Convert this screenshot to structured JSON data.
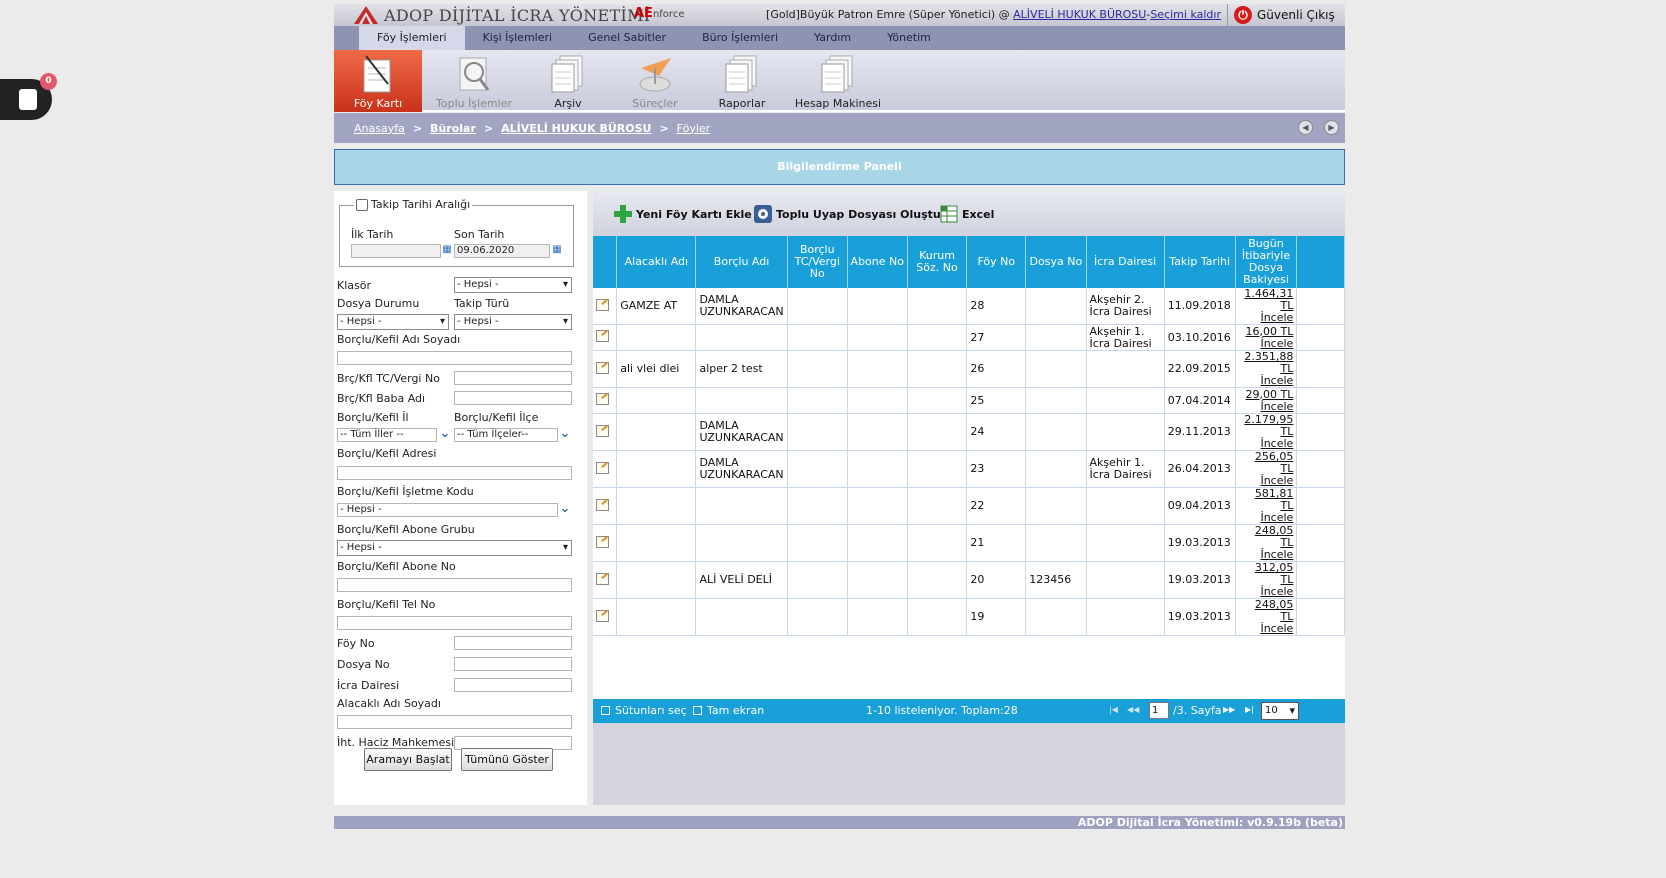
{
  "header": {
    "brand": "ADOP DİJİTAL İCRA YÖNETİMİ",
    "brand_ae": "AE",
    "brand_ae_small": "nforce",
    "user_prefix": "[Gold]Büyük Patron Emre (Süper Yönetici) @ ",
    "office_link": "ALİVELİ HUKUK BÜROSU",
    "dash": "-",
    "clear_selection": "Seçimi kaldır",
    "logout": "Güvenli Çıkış"
  },
  "menu": [
    "Föy İşlemleri",
    "Kişi İşlemleri",
    "Genel Sabitler",
    "Büro İşlemleri",
    "Yardım",
    "Yönetim"
  ],
  "toolbar": [
    {
      "label": "Föy Kartı",
      "state": "active"
    },
    {
      "label": "Toplu İşlemler",
      "state": "disabled"
    },
    {
      "label": "Arşiv",
      "state": "normal"
    },
    {
      "label": "Süreçler",
      "state": "disabled"
    },
    {
      "label": "Raporlar",
      "state": "normal"
    },
    {
      "label": "Hesap Makinesi",
      "state": "normal"
    }
  ],
  "breadcrumb": [
    "Anasayfa",
    "Bürolar",
    "ALİVELİ HUKUK BÜROSU",
    "Föyler"
  ],
  "breadcrumb_sep": ">",
  "info_panel": "Bilgilendirme Paneli",
  "filters": {
    "date_range_label": "Takip Tarihi Aralığı",
    "start_date_label": "İlk Tarih",
    "end_date_label": "Son Tarih",
    "start_date_value": "",
    "end_date_value": "09.06.2020",
    "klasor_label": "Klasör",
    "klasor_value": "- Hepsi -",
    "dosya_durumu_label": "Dosya Durumu",
    "dosya_durumu_value": "- Hepsi -",
    "takip_turu_label": "Takip Türü",
    "takip_turu_value": "- Hepsi -",
    "borclu_adi_label": "Borçlu/Kefil Adı Soyadı",
    "tc_label": "Brç/Kfl TC/Vergi No",
    "baba_label": "Brç/Kfl Baba Adı",
    "il_label": "Borçlu/Kefil İl",
    "il_value": "-- Tüm İller --",
    "ilce_label": "Borçlu/Kefil İlçe",
    "ilce_value": "-- Tüm İlçeler--",
    "adres_label": "Borçlu/Kefil Adresi",
    "isletme_label": "Borçlu/Kefil İşletme Kodu",
    "isletme_value": "- Hepsi -",
    "abone_grubu_label": "Borçlu/Kefil Abone Grubu",
    "abone_grubu_value": "- Hepsi -",
    "abone_no_label": "Borçlu/Kefil Abone No",
    "tel_label": "Borçlu/Kefil Tel No",
    "foy_no_label": "Föy No",
    "dosya_no_label": "Dosya No",
    "icra_dairesi_label": "İcra Dairesi",
    "alacakli_label": "Alacaklı Adı Soyadı",
    "haciz_label": "İht. Haciz Mahkemesi",
    "search_button": "Aramayı Başlat",
    "show_all_button": "Tümünü Göster"
  },
  "actions": {
    "new": "Yeni Föy Kartı Ekle",
    "uyap": "Toplu Uyap Dosyası Oluştur",
    "excel": "Excel"
  },
  "columns": [
    "",
    "Alacaklı Adı",
    "Borçlu Adı",
    "Borçlu TC/Vergi No",
    "Abone No",
    "Kurum Söz. No",
    "Föy No",
    "Dosya No",
    "İcra Dairesi",
    "Takip Tarihi",
    "Bugün İtibariyle Dosya Bakiyesi"
  ],
  "rows": [
    {
      "alacakli": "GAMZE AT",
      "borclu": "DAMLA UZUNKARACAN",
      "foy": "28",
      "dosya": "",
      "icra": "Akşehir 2. İcra Dairesi",
      "tarih": "11.09.2018",
      "bakiye": "1.464,31 TL",
      "incele": "İncele"
    },
    {
      "alacakli": "",
      "borclu": "",
      "foy": "27",
      "dosya": "",
      "icra": "Akşehir 1. İcra Dairesi",
      "tarih": "03.10.2016",
      "bakiye": "16,00 TL",
      "incele": "İncele"
    },
    {
      "alacakli": "ali vlei dlei",
      "borclu": "alper 2 test",
      "foy": "26",
      "dosya": "",
      "icra": "",
      "tarih": "22.09.2015",
      "bakiye": "2.351,88 TL",
      "incele": "İncele"
    },
    {
      "alacakli": "",
      "borclu": "",
      "foy": "25",
      "dosya": "",
      "icra": "",
      "tarih": "07.04.2014",
      "bakiye": "29,00 TL",
      "incele": "İncele"
    },
    {
      "alacakli": "",
      "borclu": "DAMLA UZUNKARACAN",
      "foy": "24",
      "dosya": "",
      "icra": "",
      "tarih": "29.11.2013",
      "bakiye": "2.179,95 TL",
      "incele": "İncele"
    },
    {
      "alacakli": "",
      "borclu": "DAMLA UZUNKARACAN",
      "foy": "23",
      "dosya": "",
      "icra": "Akşehir 1. İcra Dairesi",
      "tarih": "26.04.2013",
      "bakiye": "256,05 TL",
      "incele": "İncele"
    },
    {
      "alacakli": "",
      "borclu": "",
      "foy": "22",
      "dosya": "",
      "icra": "",
      "tarih": "09.04.2013",
      "bakiye": "581,81 TL",
      "incele": "İncele"
    },
    {
      "alacakli": "",
      "borclu": "",
      "foy": "21",
      "dosya": "",
      "icra": "",
      "tarih": "19.03.2013",
      "bakiye": "248,05 TL",
      "incele": "İncele"
    },
    {
      "alacakli": "",
      "borclu": "ALİ VELİ DELİ",
      "foy": "20",
      "dosya": "123456",
      "icra": "",
      "tarih": "19.03.2013",
      "bakiye": "312,05 TL",
      "incele": "İncele"
    },
    {
      "alacakli": "",
      "borclu": "",
      "foy": "19",
      "dosya": "",
      "icra": "",
      "tarih": "19.03.2013",
      "bakiye": "248,05 TL",
      "incele": "İncele"
    }
  ],
  "grid_footer": {
    "columns": "Sütunları seç",
    "fullscreen": "Tam ekran",
    "summary": "1-10 listeleniyor. Toplam:28",
    "page": "1",
    "page_total": "/3. Sayfa",
    "page_size": "10"
  },
  "footer": "ADOP Dijital İcra Yönetimi: v0.9.19b (beta)",
  "cart_count": "0"
}
